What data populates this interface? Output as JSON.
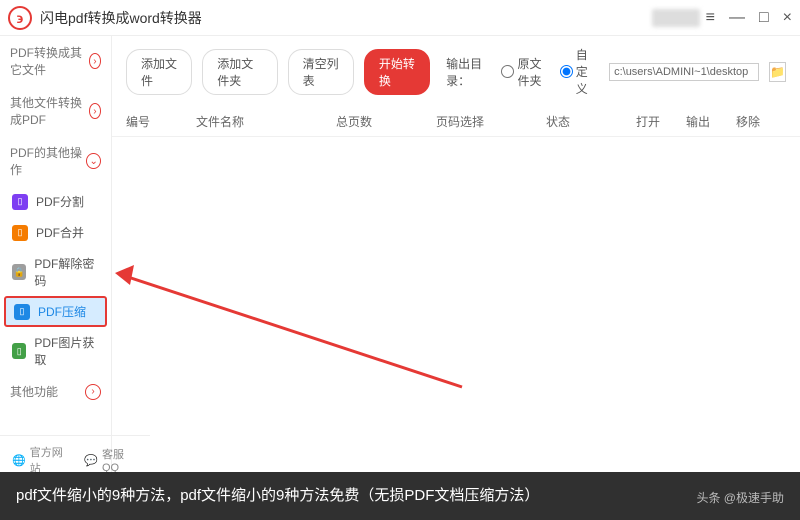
{
  "titlebar": {
    "app_name": "闪电pdf转换成word转换器",
    "menu_icon": "≡",
    "min": "—",
    "max": "□",
    "close": "×"
  },
  "sidebar": {
    "cat1": "PDF转换成其它文件",
    "cat2": "其他文件转换成PDF",
    "cat3": "PDF的其他操作",
    "items": {
      "split": "PDF分割",
      "merge": "PDF合并",
      "unlock": "PDF解除密码",
      "compress": "PDF压缩",
      "extract": "PDF图片获取"
    },
    "cat4": "其他功能"
  },
  "toolbar": {
    "add_file": "添加文件",
    "add_folder": "添加文件夹",
    "clear_list": "清空列表",
    "start": "开始转换",
    "output_label": "输出目录：",
    "radio_orig": "原文件夹",
    "radio_custom": "自定义",
    "path": "c:\\users\\ADMINI~1\\desktop"
  },
  "columns": {
    "c1": "编号",
    "c2": "文件名称",
    "c3": "总页数",
    "c4": "页码选择",
    "c5": "状态",
    "c6": "打开",
    "c7": "输出",
    "c8": "移除"
  },
  "footer": {
    "website": "官方网站",
    "qq": "客服QQ"
  },
  "caption": {
    "text": "pdf文件缩小的9种方法，pdf文件缩小的9种方法免费（无损PDF文档压缩方法）",
    "author": "头条 @极速手助"
  }
}
